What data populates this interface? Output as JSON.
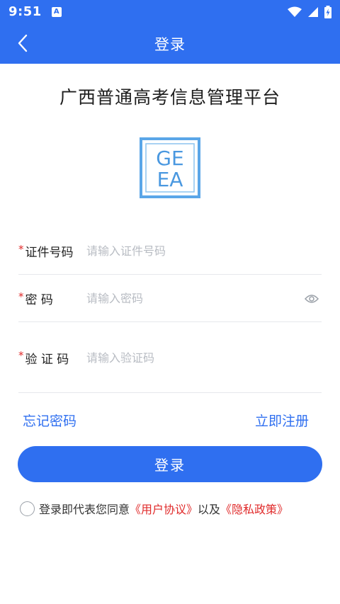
{
  "status_bar": {
    "time": "9:51",
    "app_icon_letter": "A"
  },
  "header": {
    "title": "登录"
  },
  "platform_title": "广西普通高考信息管理平台",
  "logo": {
    "top_text": "GE",
    "bottom_text": "EA"
  },
  "form": {
    "id_number": {
      "required_mark": "*",
      "label": "证件号码",
      "placeholder": "请输入证件号码"
    },
    "password": {
      "required_mark": "*",
      "label": "密 码",
      "placeholder": "请输入密码"
    },
    "captcha": {
      "required_mark": "*",
      "label": "验 证 码",
      "placeholder": "请输入验证码"
    }
  },
  "links": {
    "forgot_password": "忘记密码",
    "register": "立即注册"
  },
  "login_button": "登录",
  "agreement": {
    "prefix": "登录即代表您同意",
    "user_agreement": "《用户协议》",
    "middle": "以及",
    "privacy_policy": "《隐私政策》"
  },
  "colors": {
    "primary": "#2f6ff0",
    "required": "#e02a2a",
    "logo_blue": "#5aa6e8"
  }
}
